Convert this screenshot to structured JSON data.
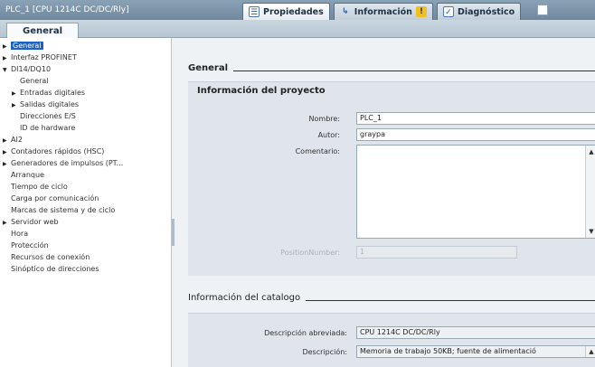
{
  "window": {
    "title": "PLC_1 [CPU 1214C DC/DC/Rly]"
  },
  "tabs": [
    {
      "label": "Propiedades",
      "icon": "properties-icon"
    },
    {
      "label": "Información",
      "icon": "info-icon"
    },
    {
      "label": "Diagnóstico",
      "icon": "diagnostics-icon"
    }
  ],
  "subtab": {
    "label": "General"
  },
  "nav": {
    "items": [
      {
        "label": "General",
        "arrow": "▶",
        "selected": true
      },
      {
        "label": "Interfaz PROFINET",
        "arrow": "▶"
      },
      {
        "label": "DI14/DQ10",
        "arrow": "▼"
      },
      {
        "label": "General",
        "arrow": "",
        "indent": 1
      },
      {
        "label": "Entradas digitales",
        "arrow": "▶",
        "indent": 1
      },
      {
        "label": "Salidas digitales",
        "arrow": "▶",
        "indent": 1
      },
      {
        "label": "Direcciones E/S",
        "arrow": "",
        "indent": 1
      },
      {
        "label": "ID de hardware",
        "arrow": "",
        "indent": 1
      },
      {
        "label": "AI2",
        "arrow": "▶"
      },
      {
        "label": "Contadores rápidos (HSC)",
        "arrow": "▶"
      },
      {
        "label": "Generadores de impulsos (PT...",
        "arrow": "▶"
      },
      {
        "label": "Arranque",
        "arrow": ""
      },
      {
        "label": "Tiempo de ciclo",
        "arrow": ""
      },
      {
        "label": "Carga por comunicación",
        "arrow": ""
      },
      {
        "label": "Marcas de sistema y de ciclo",
        "arrow": ""
      },
      {
        "label": "Servidor web",
        "arrow": "▶"
      },
      {
        "label": "Hora",
        "arrow": ""
      },
      {
        "label": "Protección",
        "arrow": ""
      },
      {
        "label": "Recursos de conexión",
        "arrow": ""
      },
      {
        "label": "Sinóptico de direcciones",
        "arrow": ""
      }
    ]
  },
  "general": {
    "heading": "General",
    "project_panel_title": "Información del proyecto",
    "name_label": "Nombre:",
    "name_value": "PLC_1",
    "author_label": "Autor:",
    "author_value": "graypa",
    "comment_label": "Comentario:",
    "comment_value": "",
    "position_label": "PositionNumber:",
    "position_value": "1"
  },
  "catalog": {
    "heading": "Información del catalogo",
    "short_desc_label": "Descripción abreviada:",
    "short_desc_value": "CPU 1214C DC/DC/Rly",
    "desc_label": "Descripción:",
    "desc_value": "Memoria de trabajo 50KB; fuente de alimentació"
  }
}
